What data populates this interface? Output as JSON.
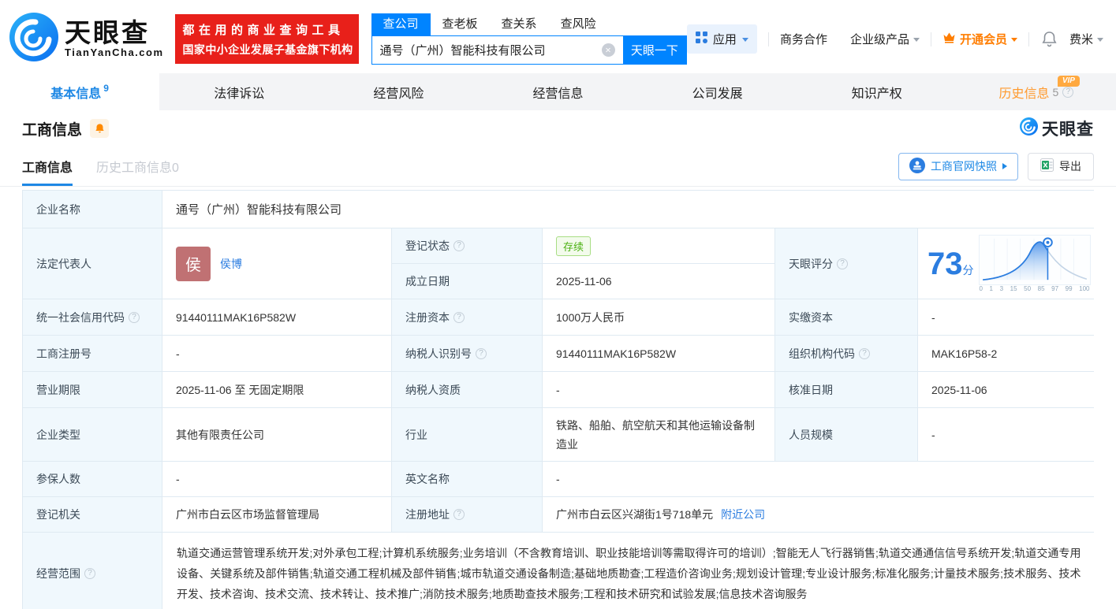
{
  "brand": {
    "name": "天眼查",
    "domain": "TianYanCha.com",
    "promo_line1": "都在用的商业查询工具",
    "promo_line2": "国家中小企业发展子基金旗下机构",
    "accent_blue": "#0084ff",
    "promo_red": "#e8201a"
  },
  "search": {
    "tabs": [
      {
        "label": "查公司",
        "active": true
      },
      {
        "label": "查老板",
        "active": false
      },
      {
        "label": "查关系",
        "active": false
      },
      {
        "label": "查风险",
        "active": false
      }
    ],
    "value": "通号（广州）智能科技有限公司",
    "button": "天眼一下"
  },
  "header_menu": {
    "apps": "应用",
    "biz_coop": "商务合作",
    "enterprise": "企业级产品",
    "vip": "开通会员",
    "user": "费米"
  },
  "nav_tabs": [
    {
      "label": "基本信息",
      "count": "9",
      "active": true
    },
    {
      "label": "法律诉讼"
    },
    {
      "label": "经营风险"
    },
    {
      "label": "经营信息"
    },
    {
      "label": "公司发展"
    },
    {
      "label": "知识产权"
    },
    {
      "label": "历史信息",
      "count": "5",
      "vip_badge": "VIP"
    }
  ],
  "section": {
    "title": "工商信息",
    "brand": "天眼查"
  },
  "subtabs": {
    "current": "工商信息",
    "history": "历史工商信息0",
    "snapshot_btn": "工商官网快照",
    "export_btn": "导出"
  },
  "score": {
    "label": "天眼评分",
    "value": "73",
    "unit": "分",
    "axis": [
      "0",
      "1",
      "3",
      "15",
      "50",
      "85",
      "97",
      "99",
      "100"
    ],
    "color": "#2b7de0"
  },
  "table": {
    "labels": {
      "company_name": "企业名称",
      "legal_rep": "法定代表人",
      "reg_status": "登记状态",
      "establish_date": "成立日期",
      "credit_code": "统一社会信用代码",
      "reg_capital": "注册资本",
      "paid_capital": "实缴资本",
      "reg_number": "工商注册号",
      "taxpayer_id": "纳税人识别号",
      "org_code": "组织机构代码",
      "business_term": "营业期限",
      "taxpayer_quality": "纳税人资质",
      "approve_date": "核准日期",
      "company_type": "企业类型",
      "industry": "行业",
      "staff_size": "人员规模",
      "insured_count": "参保人数",
      "english_name": "英文名称",
      "reg_authority": "登记机关",
      "reg_address": "注册地址",
      "business_scope": "经营范围"
    },
    "values": {
      "company_name": "通号（广州）智能科技有限公司",
      "legal_rep_avatar": "侯",
      "legal_rep_name": "侯博",
      "reg_status": "存续",
      "establish_date": "2025-11-06",
      "credit_code": "91440111MAK16P582W",
      "reg_capital": "1000万人民币",
      "paid_capital": "-",
      "reg_number": "-",
      "taxpayer_id": "91440111MAK16P582W",
      "org_code": "MAK16P58-2",
      "business_term": "2025-11-06 至 无固定期限",
      "taxpayer_quality": "-",
      "approve_date": "2025-11-06",
      "company_type": "其他有限责任公司",
      "industry": "铁路、船舶、航空航天和其他运输设备制造业",
      "staff_size": "-",
      "insured_count": "-",
      "english_name": "-",
      "reg_authority": "广州市白云区市场监督管理局",
      "reg_address": "广州市白云区兴湖街1号718单元",
      "nearby_link": "附近公司",
      "business_scope": "轨道交通运营管理系统开发;对外承包工程;计算机系统服务;业务培训（不含教育培训、职业技能培训等需取得许可的培训）;智能无人飞行器销售;轨道交通通信信号系统开发;轨道交通专用设备、关键系统及部件销售;轨道交通工程机械及部件销售;城市轨道交通设备制造;基础地质勘查;工程造价咨询业务;规划设计管理;专业设计服务;标准化服务;计量技术服务;技术服务、技术开发、技术咨询、技术交流、技术转让、技术推广;消防技术服务;地质勘查技术服务;工程和技术研究和试验发展;信息技术咨询服务"
    }
  }
}
